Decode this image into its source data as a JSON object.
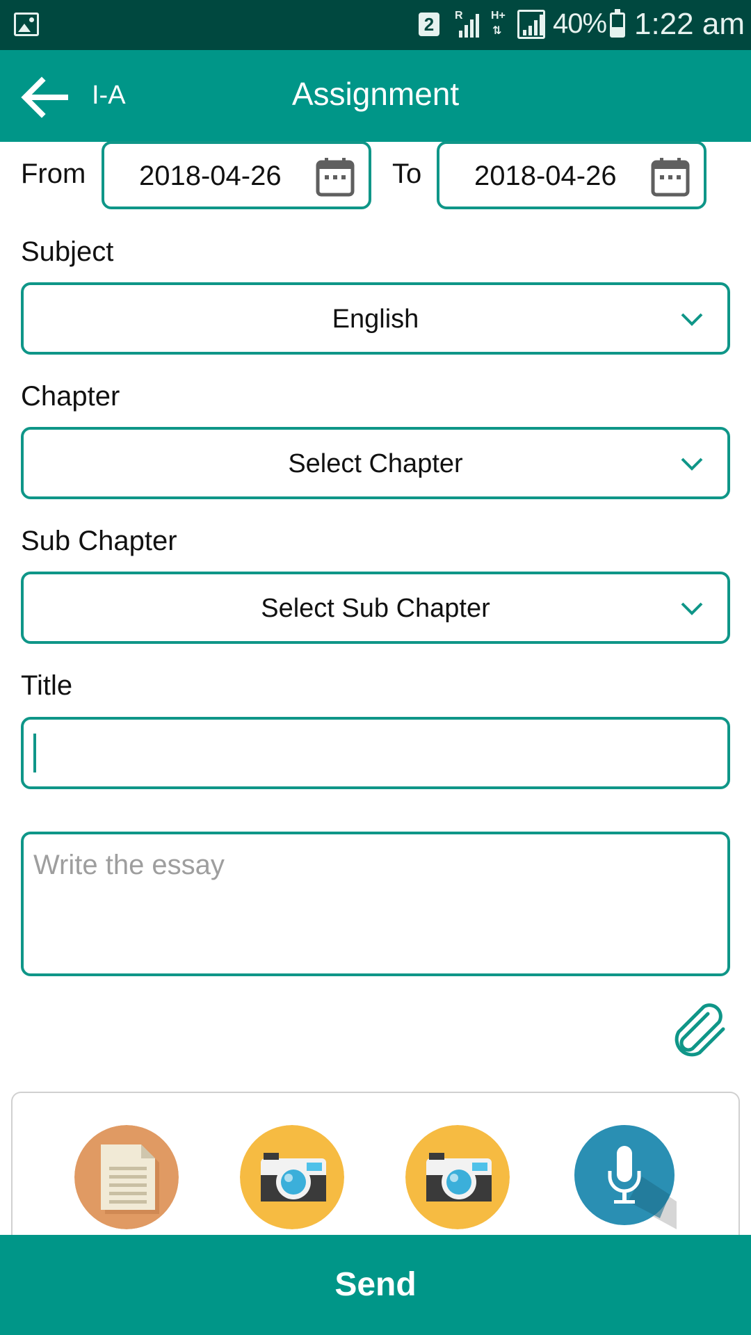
{
  "status_bar": {
    "sim_slot": "2",
    "roaming_mark": "R",
    "network_type": "H+",
    "battery": "40%",
    "time": "1:22 am"
  },
  "app_bar": {
    "class_label": "I-A",
    "title": "Assignment"
  },
  "date_range": {
    "from_label": "From",
    "from_value": "2018-04-26",
    "to_label": "To",
    "to_value": "2018-04-26"
  },
  "subject": {
    "label": "Subject",
    "selected": "English"
  },
  "chapter": {
    "label": "Chapter",
    "selected": "Select Chapter"
  },
  "sub_chapter": {
    "label": "Sub Chapter",
    "selected": "Select Sub Chapter"
  },
  "title_field": {
    "label": "Title",
    "value": ""
  },
  "essay": {
    "placeholder": "Write the essay",
    "value": ""
  },
  "attachments": [
    {
      "icon": "document-icon",
      "color": "#e09a63"
    },
    {
      "icon": "camera-icon",
      "color": "#f6bb42"
    },
    {
      "icon": "camera-icon",
      "color": "#f6bb42"
    },
    {
      "icon": "microphone-icon",
      "color": "#2a8fb3"
    }
  ],
  "send_label": "Send",
  "colors": {
    "accent": "#009688",
    "status_bar": "#00483f",
    "field_border": "#0f9688"
  }
}
